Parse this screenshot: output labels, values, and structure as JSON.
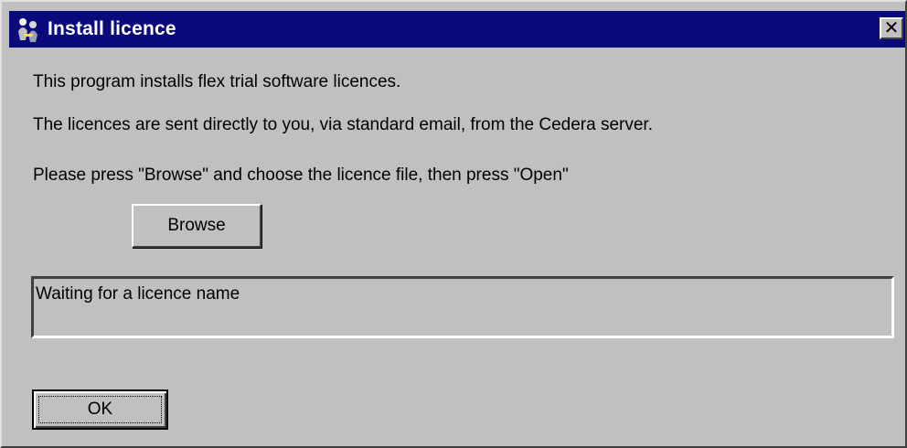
{
  "window": {
    "title": "Install licence",
    "close_glyph": "✕",
    "titlebar_color": "#0a0a7a",
    "face_color": "#c0c0c0"
  },
  "body": {
    "line1": "This program installs flex trial software licences.",
    "line2": "The licences are sent directly to you, via standard email, from the Cedera server.",
    "line3": "Please press \"Browse\" and choose the licence file, then press \"Open\""
  },
  "buttons": {
    "browse_label": "Browse",
    "ok_label": "OK"
  },
  "status": {
    "text": "Waiting for a licence name"
  },
  "icons": {
    "app": "install-people-icon",
    "close": "close-icon"
  }
}
